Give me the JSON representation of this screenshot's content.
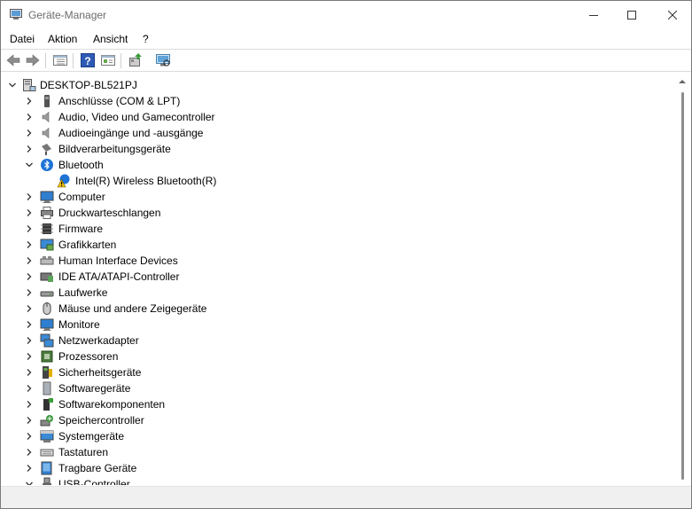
{
  "window": {
    "title": "Geräte-Manager"
  },
  "menu": [
    "Datei",
    "Aktion",
    "Ansicht",
    "?"
  ],
  "toolbar": [
    "back",
    "forward",
    "properties",
    "help",
    "view",
    "update-driver",
    "scan-hardware"
  ],
  "tree": {
    "root": "DESKTOP-BL521PJ",
    "items": [
      {
        "label": "Anschlüsse (COM & LPT)",
        "icon": "port-icon"
      },
      {
        "label": "Audio, Video und Gamecontroller",
        "icon": "speaker-icon"
      },
      {
        "label": "Audioeingänge und -ausgänge",
        "icon": "speaker-icon"
      },
      {
        "label": "Bildverarbeitungsgeräte",
        "icon": "camera-icon"
      },
      {
        "label": "Bluetooth",
        "icon": "bluetooth-icon",
        "expanded": true,
        "children": [
          {
            "label": "Intel(R) Wireless Bluetooth(R)",
            "icon": "warning-bluetooth-icon"
          }
        ]
      },
      {
        "label": "Computer",
        "icon": "monitor-icon"
      },
      {
        "label": "Druckwarteschlangen",
        "icon": "printer-icon"
      },
      {
        "label": "Firmware",
        "icon": "chip-icon"
      },
      {
        "label": "Grafikkarten",
        "icon": "display-adapter-icon"
      },
      {
        "label": "Human Interface Devices",
        "icon": "hid-icon"
      },
      {
        "label": "IDE ATA/ATAPI-Controller",
        "icon": "ide-icon"
      },
      {
        "label": "Laufwerke",
        "icon": "drive-icon"
      },
      {
        "label": "Mäuse und andere Zeigegeräte",
        "icon": "mouse-icon"
      },
      {
        "label": "Monitore",
        "icon": "monitor-icon"
      },
      {
        "label": "Netzwerkadapter",
        "icon": "network-icon"
      },
      {
        "label": "Prozessoren",
        "icon": "cpu-icon"
      },
      {
        "label": "Sicherheitsgeräte",
        "icon": "security-icon"
      },
      {
        "label": "Softwaregeräte",
        "icon": "software-device-icon"
      },
      {
        "label": "Softwarekomponenten",
        "icon": "software-component-icon"
      },
      {
        "label": "Speichercontroller",
        "icon": "storage-icon"
      },
      {
        "label": "Systemgeräte",
        "icon": "system-icon"
      },
      {
        "label": "Tastaturen",
        "icon": "keyboard-icon"
      },
      {
        "label": "Tragbare Geräte",
        "icon": "portable-icon"
      },
      {
        "label": "USB-Controller",
        "icon": "usb-icon",
        "expanded": true
      }
    ]
  },
  "colors": {
    "accent": "#1e73d6",
    "text": "#000000"
  }
}
